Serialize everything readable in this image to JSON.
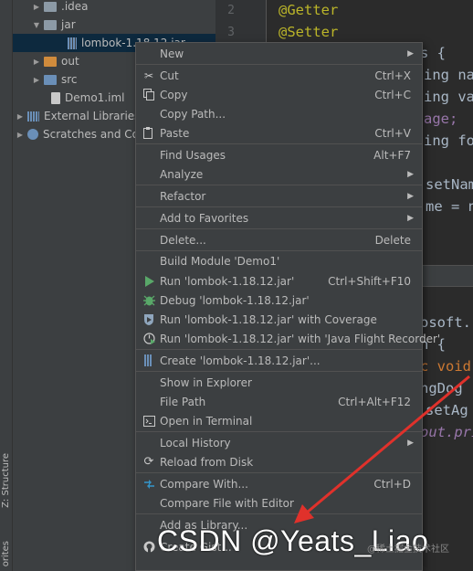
{
  "side_tabs": {
    "structure": "Z: Structure",
    "favorites": "orites"
  },
  "tree": {
    "items": [
      {
        "label": ".idea",
        "icon": "folder-icon",
        "expanded": false
      },
      {
        "label": "jar",
        "icon": "folder-icon",
        "expanded": true
      },
      {
        "label": "lombok-1.18.12.jar",
        "icon": "jar-icon",
        "selected": true
      },
      {
        "label": "out",
        "icon": "folder-icon",
        "expanded": false
      },
      {
        "label": "src",
        "icon": "folder-icon",
        "expanded": false
      },
      {
        "label": "Demo1.iml",
        "icon": "iml-file-icon"
      },
      {
        "label": "External Libraries",
        "icon": "library-icon",
        "expanded": false
      },
      {
        "label": "Scratches and Con",
        "icon": "scratches-icon",
        "expanded": false
      }
    ]
  },
  "editor": {
    "line_numbers": [
      "2",
      "3"
    ],
    "top_lines": [
      {
        "text": "@Getter",
        "style": "annotation"
      },
      {
        "text": "@Setter",
        "style": "annotation"
      }
    ],
    "right_fragments": [
      "s {",
      "ing nam",
      "ing val",
      "age;",
      "ing foo",
      "",
      "setNam",
      "me = na"
    ],
    "lower_fragments": [
      "osoft.",
      "n {",
      "c void",
      "ngDog",
      "setAg",
      "out.pri"
    ]
  },
  "context_menu": {
    "items": [
      {
        "label": "New",
        "shortcut": "",
        "submenu": true,
        "icon": ""
      },
      {
        "label": "Cut",
        "shortcut": "Ctrl+X",
        "icon": "scissors-icon"
      },
      {
        "label": "Copy",
        "shortcut": "Ctrl+C",
        "icon": "copy-icon"
      },
      {
        "label": "Copy Path...",
        "shortcut": "",
        "icon": ""
      },
      {
        "label": "Paste",
        "shortcut": "Ctrl+V",
        "icon": "paste-icon"
      },
      {
        "label": "Find Usages",
        "shortcut": "Alt+F7",
        "icon": ""
      },
      {
        "label": "Analyze",
        "shortcut": "",
        "submenu": true,
        "icon": ""
      },
      {
        "label": "Refactor",
        "shortcut": "",
        "submenu": true,
        "icon": ""
      },
      {
        "label": "Add to Favorites",
        "shortcut": "",
        "submenu": true,
        "icon": ""
      },
      {
        "label": "Delete...",
        "shortcut": "Delete",
        "icon": ""
      },
      {
        "label": "Build Module 'Demo1'",
        "shortcut": "",
        "icon": ""
      },
      {
        "label": "Run 'lombok-1.18.12.jar'",
        "shortcut": "Ctrl+Shift+F10",
        "icon": "run-icon"
      },
      {
        "label": "Debug 'lombok-1.18.12.jar'",
        "shortcut": "",
        "icon": "debug-icon"
      },
      {
        "label": "Run 'lombok-1.18.12.jar' with Coverage",
        "shortcut": "",
        "icon": "coverage-icon"
      },
      {
        "label": "Run 'lombok-1.18.12.jar' with 'Java Flight Recorder'",
        "shortcut": "",
        "icon": "profiler-icon"
      },
      {
        "label": "Create 'lombok-1.18.12.jar'...",
        "shortcut": "",
        "icon": "jar-config-icon"
      },
      {
        "label": "Show in Explorer",
        "shortcut": "",
        "icon": ""
      },
      {
        "label": "File Path",
        "shortcut": "Ctrl+Alt+F12",
        "icon": ""
      },
      {
        "label": "Open in Terminal",
        "shortcut": "",
        "icon": "terminal-icon"
      },
      {
        "label": "Local History",
        "shortcut": "",
        "submenu": true,
        "icon": ""
      },
      {
        "label": "Reload from Disk",
        "shortcut": "",
        "icon": "reload-icon"
      },
      {
        "label": "Compare With...",
        "shortcut": "Ctrl+D",
        "icon": "compare-icon"
      },
      {
        "label": "Compare File with Editor",
        "shortcut": "",
        "icon": ""
      },
      {
        "label": "Add as Library...",
        "shortcut": "",
        "icon": ""
      },
      {
        "label": "Create Gist...",
        "shortcut": "",
        "icon": "github-icon"
      }
    ]
  },
  "watermark": {
    "text": "CSDN @Yeats_Liao",
    "small": "@稀土掘金技术社区"
  },
  "colors": {
    "annotation": "#bbb529",
    "keyword": "#cc7832",
    "arrow": "#e0312b",
    "selection": "#0d293e"
  }
}
